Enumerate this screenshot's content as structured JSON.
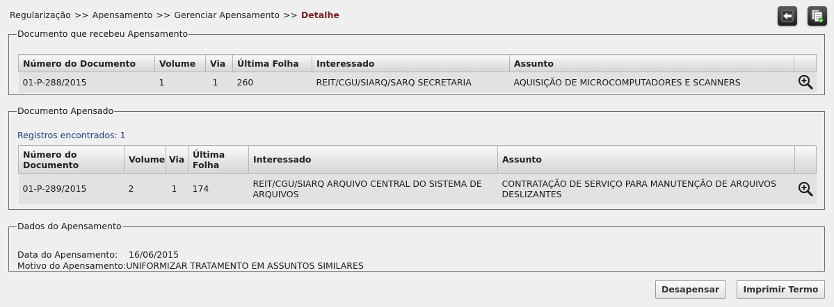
{
  "breadcrumb": {
    "items": [
      "Regularização",
      "Apensamento",
      "Gerenciar Apensamento"
    ],
    "separator": ">>",
    "current": "Detalhe"
  },
  "toolbar": {
    "back_icon": "back-arrow-icon",
    "copy_icon": "copy-document-icon"
  },
  "receiver": {
    "legend": "Documento que recebeu Apensamento",
    "headers": [
      "Número do Documento",
      "Volume",
      "Via",
      "Última Folha",
      "Interessado",
      "Assunto"
    ],
    "row": {
      "numero": "01-P-288/2015",
      "volume": "1",
      "via": "1",
      "ultima_folha": "260",
      "interessado": "REIT/CGU/SIARQ/SARQ SECRETARIA",
      "assunto": "AQUISIÇÃO DE MICROCOMPUTADORES E SCANNERS"
    }
  },
  "attached": {
    "legend": "Documento Apensado",
    "records_label": "Registros encontrados: 1",
    "headers": [
      "Número do Documento",
      "Volume",
      "Via",
      "Última Folha",
      "Interessado",
      "Assunto"
    ],
    "row": {
      "numero": "01-P-289/2015",
      "volume": "2",
      "via": "1",
      "ultima_folha": "174",
      "interessado": "REIT/CGU/SIARQ ARQUIVO CENTRAL DO SISTEMA DE ARQUIVOS",
      "assunto": "CONTRATAÇÃO DE SERVIÇO PARA MANUTENÇÃO DE ARQUIVOS DESLIZANTES"
    }
  },
  "data": {
    "legend": "Dados do Apensamento",
    "date_label": "Data do Apensamento:",
    "date_value": "16/06/2015",
    "reason_label": "Motivo do Apensamento:",
    "reason_value": "UNIFORMIZAR TRATAMENTO EM ASSUNTOS SIMILARES"
  },
  "actions": {
    "detach_label": "Desapensar",
    "print_label": "Imprimir Termo"
  },
  "colors": {
    "current_breadcrumb": "#7a1f1f",
    "records_text": "#1f3d7a",
    "row_background": "#e2e2e2"
  }
}
